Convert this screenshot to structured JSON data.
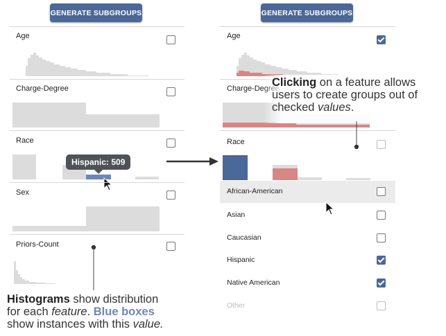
{
  "left_panel": {
    "generate_button": "GENERATE SUBGROUPS",
    "features": [
      "Age",
      "Charge-Degree",
      "Race",
      "Sex",
      "Priors-Count"
    ],
    "tooltip": "Hispanic: 509"
  },
  "right_panel": {
    "generate_button": "GENERATE SUBGROUPS",
    "features": [
      "Age",
      "Charge-Degree",
      "Race"
    ],
    "race_values": [
      {
        "label": "African-American",
        "checked": false
      },
      {
        "label": "Asian",
        "checked": false
      },
      {
        "label": "Caucasian",
        "checked": false
      },
      {
        "label": "Hispanic",
        "checked": true
      },
      {
        "label": "Native American",
        "checked": true
      },
      {
        "label": "Other",
        "checked": false
      }
    ]
  },
  "annotations": {
    "clicking_bold": "Clicking",
    "clicking_rest_1": " on a feature allows",
    "clicking_line2": "users to create groups out of",
    "clicking_line3a": "checked ",
    "clicking_line3_italic": "values",
    "clicking_line3b": ".",
    "hist_bold": "Histograms",
    "hist_rest_1": " show distribution",
    "hist_line2a": "for each ",
    "hist_line2_italic": "feature",
    "hist_line2b": ". ",
    "hist_line2_blue": "Blue boxes",
    "hist_line3a": "show instances with this ",
    "hist_line3_italic": "value."
  },
  "colors": {
    "accent": "#4a6898",
    "red": "#d88585",
    "gray_bar": "#dcdcdc"
  }
}
